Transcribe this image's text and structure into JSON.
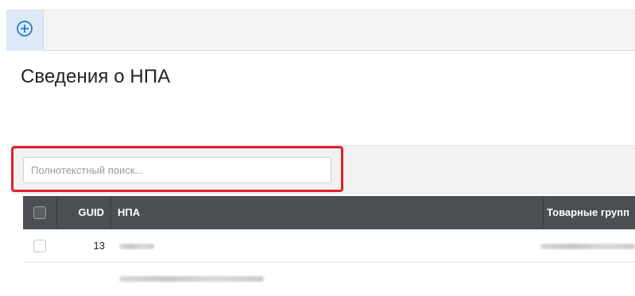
{
  "toolbar": {
    "add_icon": "plus-circle-icon",
    "accent": "#1e78c8"
  },
  "page": {
    "title": "Сведения о НПА"
  },
  "search": {
    "placeholder": "Полнотекстный поиск..."
  },
  "highlight_color": "#e0202a",
  "table": {
    "columns": [
      "GUID",
      "НПА",
      "Товарные групп"
    ],
    "rows": [
      {
        "guid": "13"
      }
    ]
  }
}
